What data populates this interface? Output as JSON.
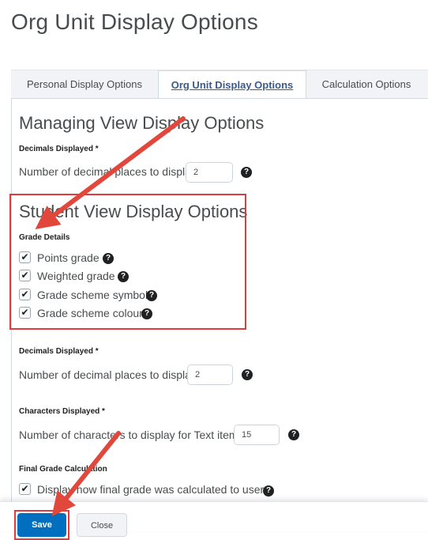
{
  "page": {
    "title": "Org Unit Display Options"
  },
  "tabs": [
    {
      "label": "Personal Display Options",
      "active": false
    },
    {
      "label": "Org Unit Display Options",
      "active": true
    },
    {
      "label": "Calculation Options",
      "active": false
    }
  ],
  "managing": {
    "heading": "Managing View Display Options",
    "decimals_label": "Decimals Displayed *",
    "decimals_text": "Number of decimal places to display",
    "decimals_value": "2"
  },
  "student": {
    "heading": "Student View Display Options",
    "grade_details_label": "Grade Details",
    "checkboxes": [
      {
        "label": "Points grade",
        "checked": true
      },
      {
        "label": "Weighted grade",
        "checked": true
      },
      {
        "label": "Grade scheme symbol",
        "checked": true
      },
      {
        "label": "Grade scheme colour",
        "checked": true
      }
    ],
    "decimals_label": "Decimals Displayed *",
    "decimals_text": "Number of decimal places to display",
    "decimals_value": "2",
    "characters_label": "Characters Displayed *",
    "characters_text": "Number of characters to display for Text items",
    "characters_value": "15",
    "final_label": "Final Grade Calculation",
    "final_text": "Display how final grade was calculated to users",
    "final_checked": true
  },
  "footer": {
    "save_label": "Save",
    "close_label": "Close"
  },
  "icons": {
    "help": "question-circle-icon",
    "check": "checkmark-icon"
  },
  "colors": {
    "highlight": "#e23b3b",
    "primary": "#006fbf",
    "active_tab_text": "#3a5a8c"
  }
}
